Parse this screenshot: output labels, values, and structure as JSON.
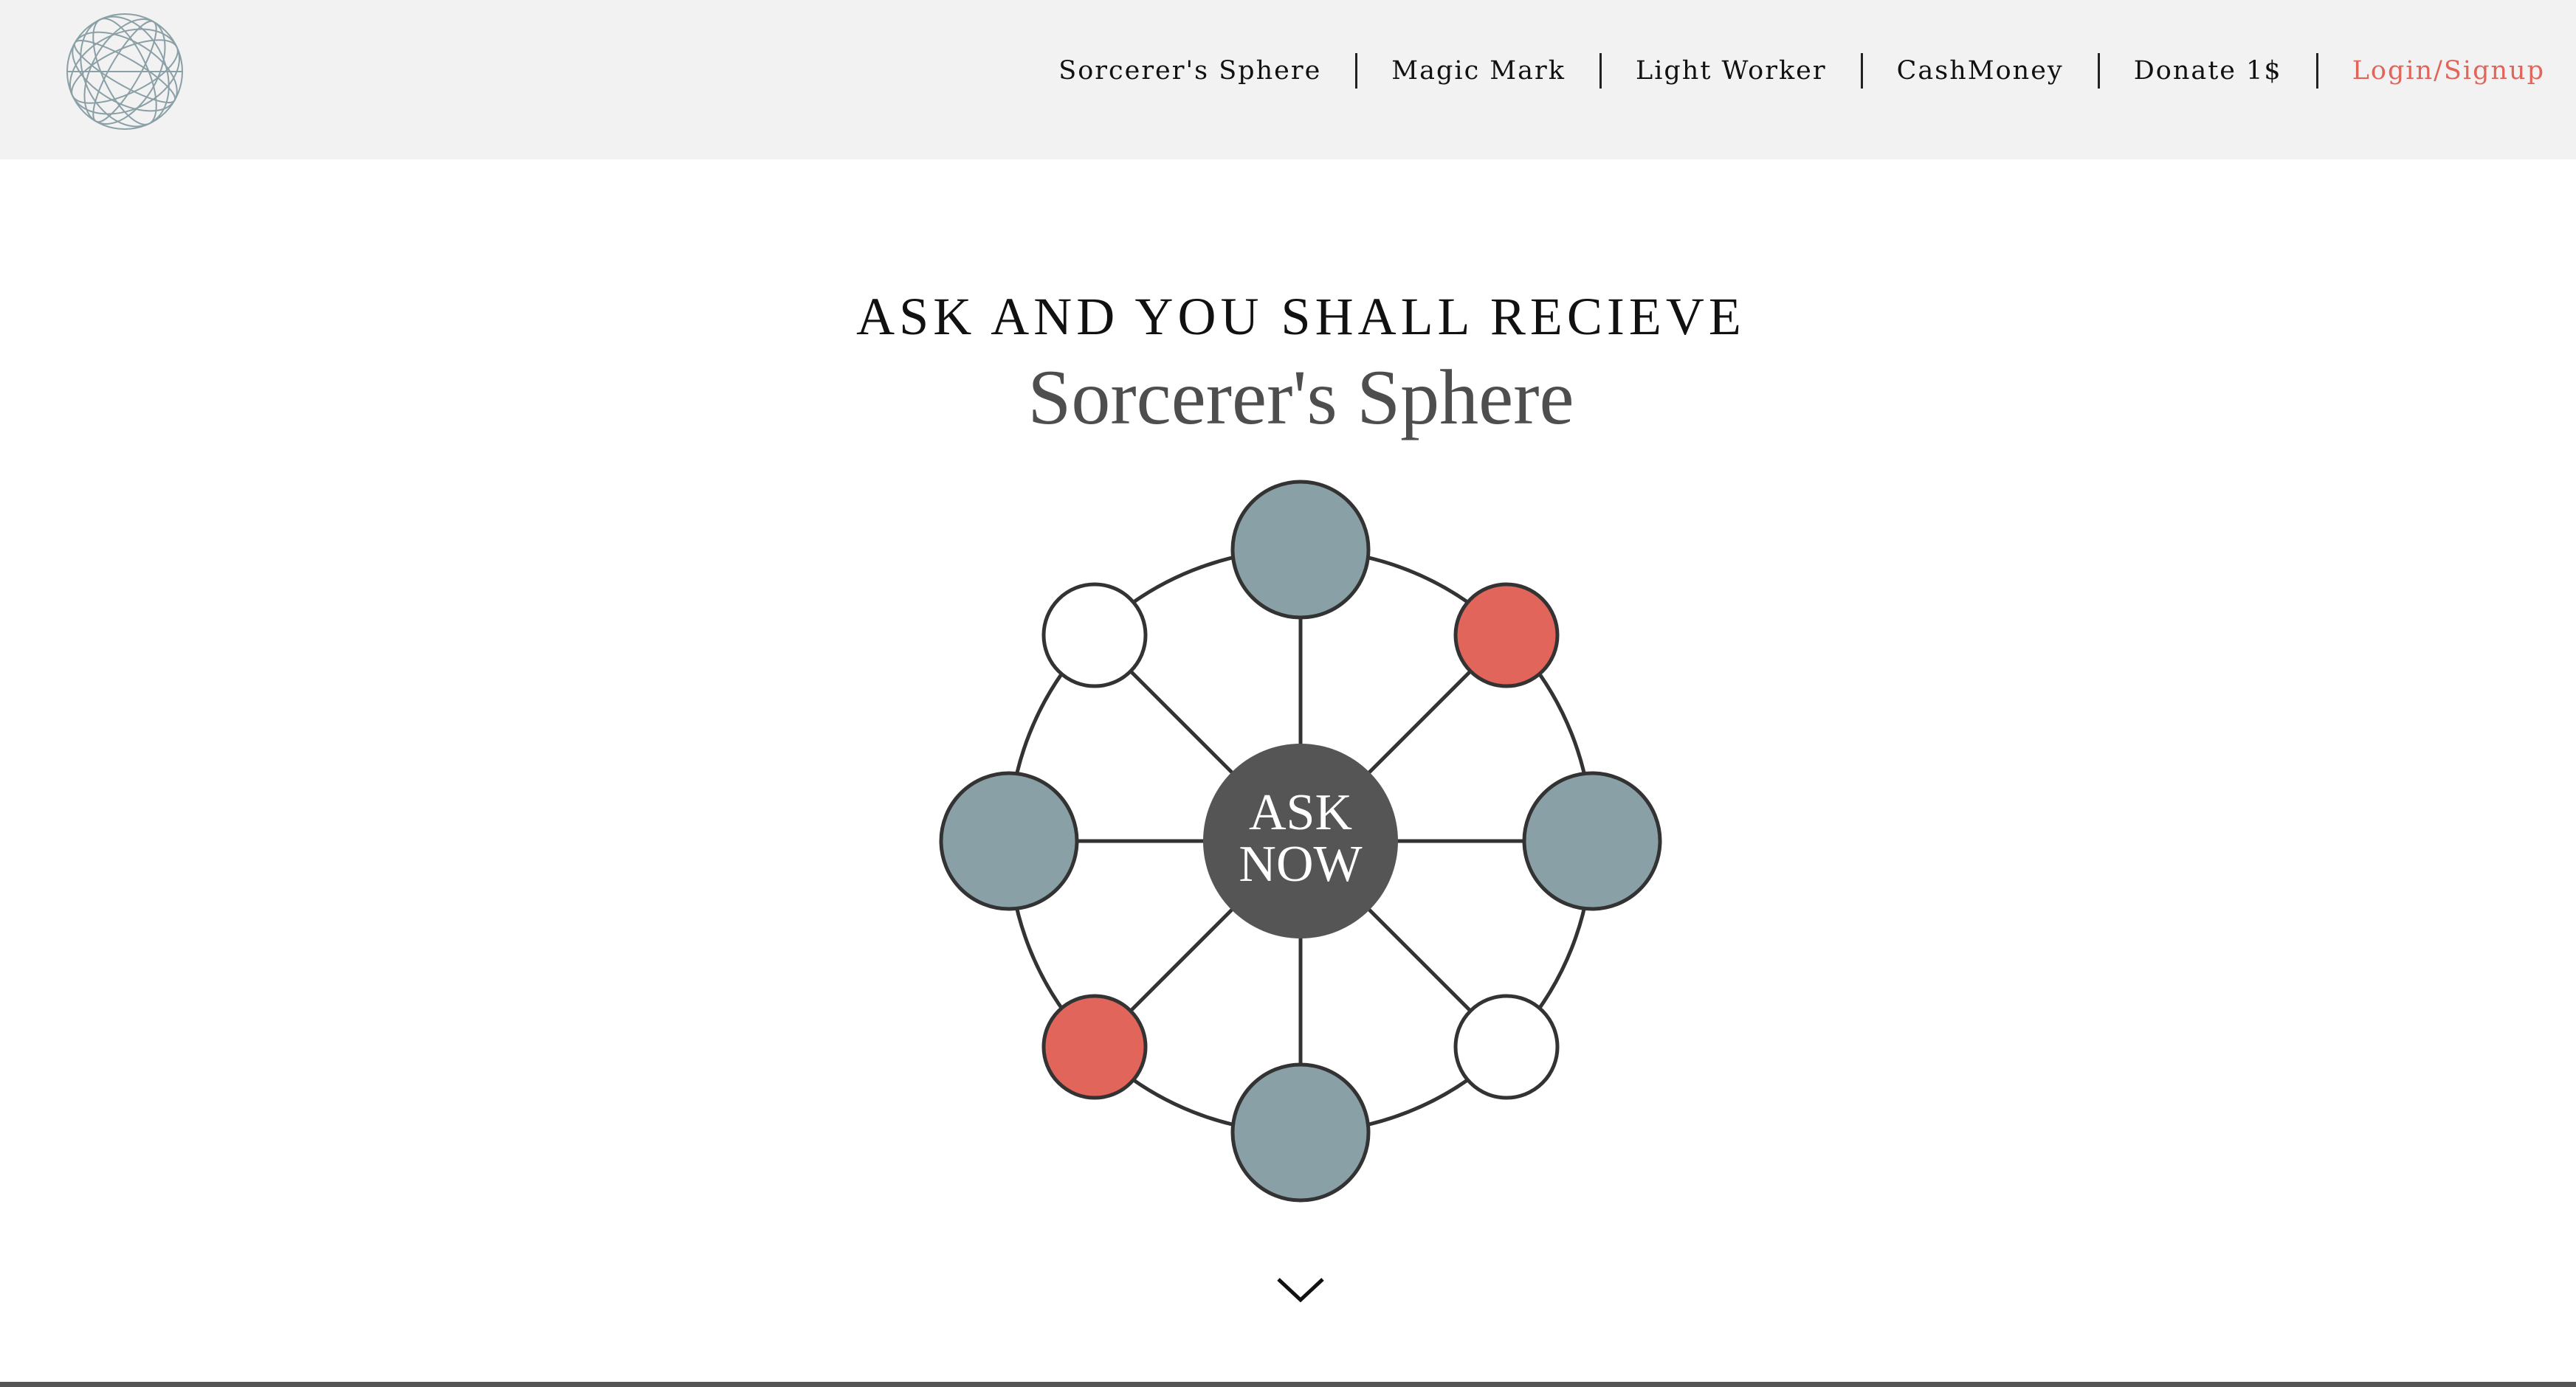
{
  "logo": {
    "icon": "globe-icon",
    "color": "#8aa0a6"
  },
  "nav": {
    "items": [
      {
        "label": "Sorcerer's Sphere"
      },
      {
        "label": "Magic Mark"
      },
      {
        "label": "Light Worker"
      },
      {
        "label": "CashMoney"
      },
      {
        "label": "Donate 1$"
      }
    ],
    "login_label": "Login/Signup",
    "login_color": "#e1655a"
  },
  "hero": {
    "kicker": "ASK AND YOU SHALL RECIEVE",
    "title": "Sorcerer's Sphere"
  },
  "sphere": {
    "center_line1": "ASK",
    "center_line2": "NOW",
    "center_color": "#555555",
    "node_colors": {
      "slate": "#89a0a6",
      "coral": "#e1655a",
      "white": "#ffffff"
    },
    "nodes": [
      "slate",
      "coral",
      "slate",
      "white",
      "slate",
      "coral",
      "slate",
      "white"
    ]
  },
  "scroll_icon": "chevron-down-icon"
}
